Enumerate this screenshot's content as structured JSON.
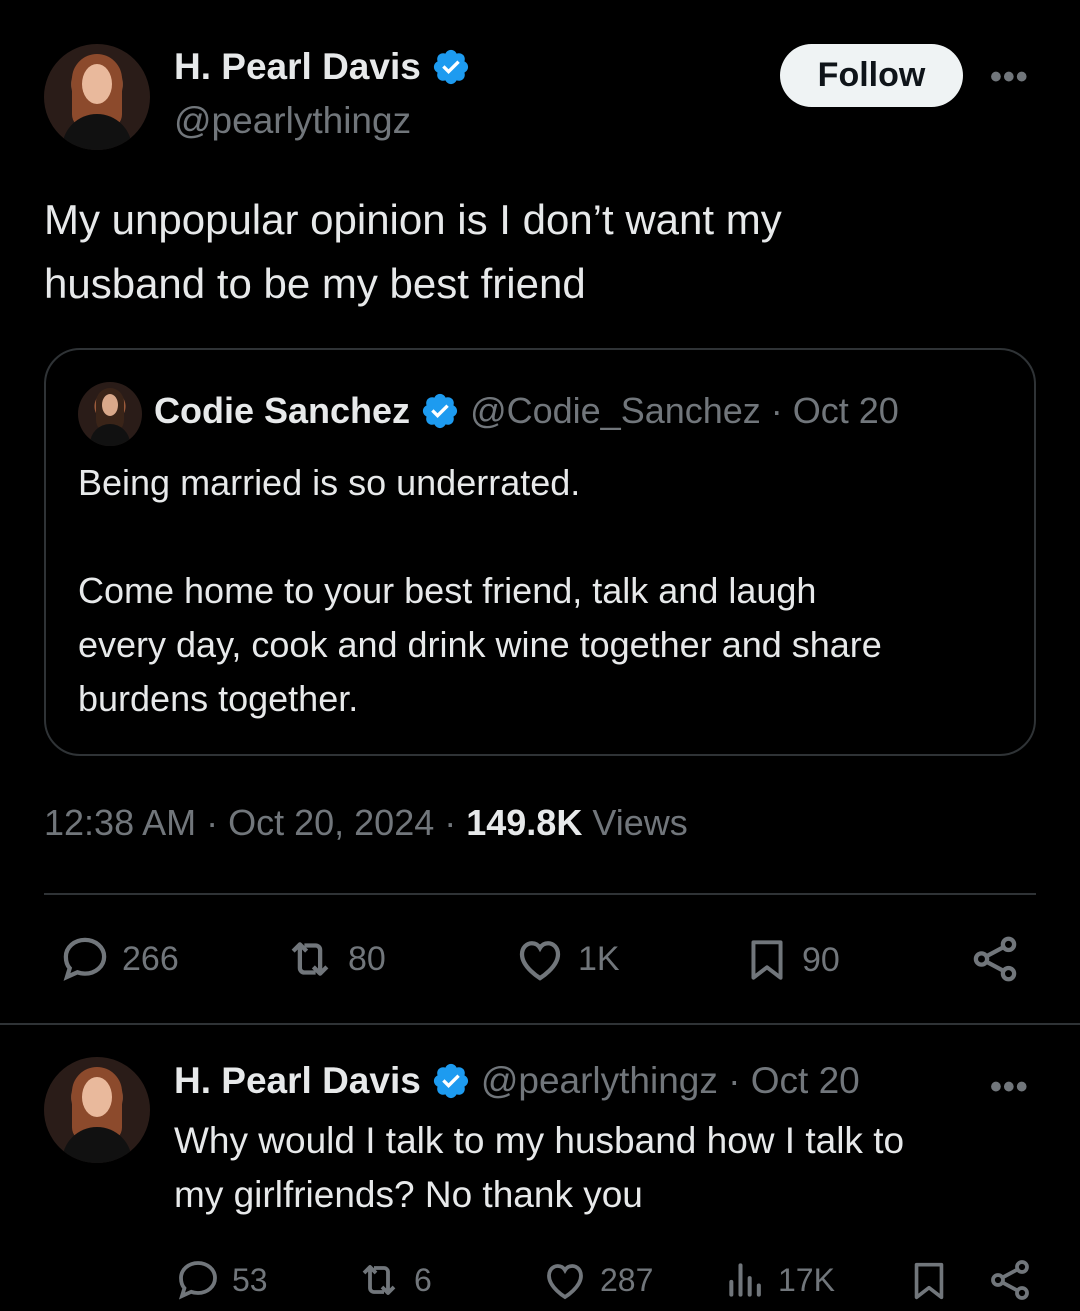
{
  "main_tweet": {
    "author_name": "H. Pearl Davis",
    "handle": "@pearlythingz",
    "follow_label": "Follow",
    "more_label": "•••",
    "text_line1": "My unpopular opinion is I don’t want my",
    "text_line2": "husband to be my best friend",
    "timestamp": "12:38 AM · Oct 20, 2024 · ",
    "views_count": "149.8K",
    "views_label": " Views",
    "actions": {
      "replies": "266",
      "retweets": "80",
      "likes": "1K",
      "bookmarks": "90"
    }
  },
  "quoted_tweet": {
    "author_name": "Codie Sanchez",
    "handle_date": "@Codie_Sanchez · Oct 20",
    "line1": "Being married is so underrated.",
    "line2": "Come home to your best friend, talk and laugh",
    "line3": "every day, cook and drink wine together and share",
    "line4": "burdens together."
  },
  "reply_tweet": {
    "author_name": "H. Pearl Davis",
    "handle_date": "@pearlythingz · Oct 20",
    "more_label": "•••",
    "text_line1": "Why would I talk to my husband how I talk to",
    "text_line2": "my girlfriends? No thank you",
    "actions": {
      "replies": "53",
      "retweets": "6",
      "likes": "287",
      "views": "17K"
    }
  },
  "colors": {
    "background": "#000000",
    "text": "#e7e9ea",
    "muted": "#71767b",
    "verified": "#1d9bf0",
    "border": "#2f3336"
  }
}
